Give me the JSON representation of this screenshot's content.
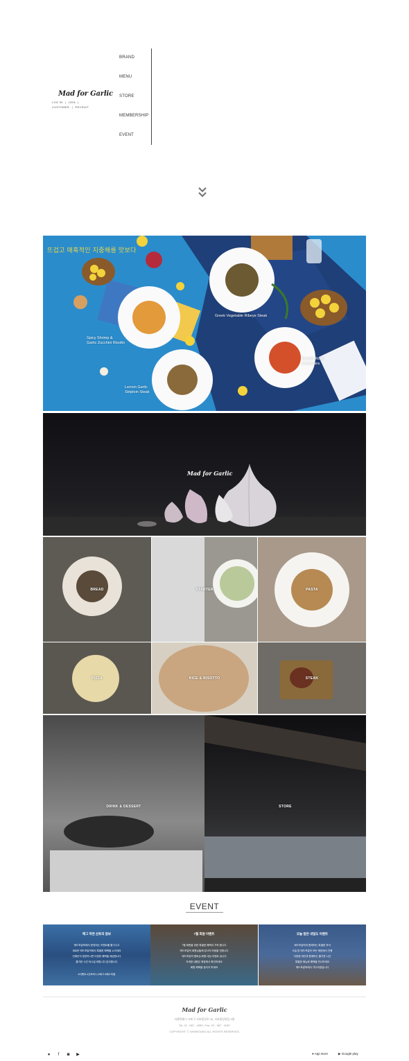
{
  "header": {
    "logo": "Mad for Garlic",
    "util_links": [
      "LOG IN",
      "|",
      "JOIN",
      "|",
      "CUSTOMER",
      "|",
      "RECRUIT"
    ],
    "nav": [
      "BRAND",
      "MENU",
      "STORE",
      "MEMBERSHIP",
      "EVENT"
    ]
  },
  "hero": {
    "title": "뜨겁고 매혹적인 지중해를 맛보다",
    "dishes": [
      {
        "name": "Greek Vegetable Ribeye Steak"
      },
      {
        "name": "Spicy Shrimp &",
        "name2": "Garlic Zucchini Risotto"
      },
      {
        "name": "Tomato Rose",
        "name2": "Carbonara"
      },
      {
        "name": "Lemon Garlic",
        "name2": "Striploin Steak"
      }
    ]
  },
  "brand_banner": {
    "logo": "Mad for Garlic"
  },
  "menu": {
    "tiles": [
      "BREAD",
      "STARTER",
      "PASTA",
      "PIZZA",
      "RICE & RISOTTO",
      "STEAK"
    ],
    "large": [
      "DRINK & DESSERT",
      "STORE"
    ]
  },
  "event": {
    "title": "EVENT",
    "cards": [
      {
        "title": "매그 하면 산토리 맘보",
        "body": [
          "매드포갈릭에서 운영되는 이벤트를 즐기시고",
          "새로운 매드포갈릭에서 특별한 혜택을 누리세요",
          "언제든지 방문하시면 다양한 혜택을 제공합니다",
          "즐거운 시간 되시길 바랍니다 감사합니다"
        ],
        "date": "#이벤트 #산토리니 #매그 #페스티벌"
      },
      {
        "title": "7월 회원 이벤트",
        "body": [
          "7월 회원을 위한 특별한 혜택이 가득 합니다",
          "매드포갈릭 회원님들께 감사의 마음을 전합니다",
          "매드포갈릭 멤버십 회원 대상 이벤트 입니다",
          "자세한 내용은 매장에서 확인하세요",
          "회원 혜택을 놓치지 마세요"
        ],
        "date": ""
      },
      {
        "title": "오늘 밤은 내일도 이벤트",
        "body": [
          "매드포갈릭과 함께하는 특별한 저녁",
          "오늘 밤 매드포갈릭 모든 매장에서 진행",
          "다양한 와인과 함께하는 즐거운 시간",
          "특별한 메뉴와 혜택을 만나보세요",
          "매드포갈릭에서 기다리겠습니다"
        ],
        "date": ""
      }
    ]
  },
  "footer": {
    "logo": "Mad for Garlic",
    "address": "서울특별시 서초구 서초중앙로 26, 서초중앙빌딩 5층",
    "tel": "Tel. 02 - 587 - 4085 / Fax. 02 - 587 - 4087",
    "copyright": "COPYRIGHT ⓒ WWWOUNG ALL RIGHTS RESERVED.",
    "app_store": "App store",
    "google_play": "Google play"
  },
  "colors": {
    "hero_bg": "#2f8fcf",
    "event_title_line": "#999999",
    "accent_yellow": "#e8d64a"
  }
}
